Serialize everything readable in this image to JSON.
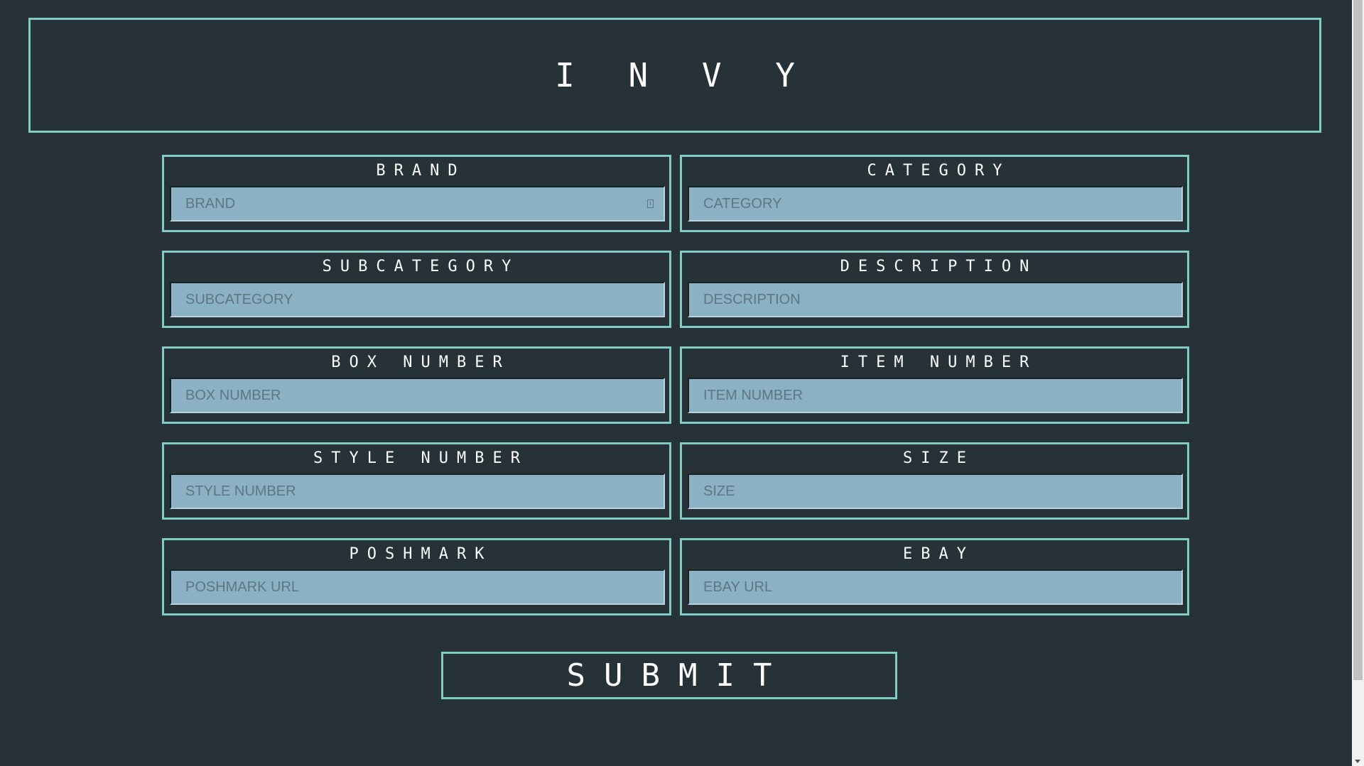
{
  "app": {
    "title": "I N V Y"
  },
  "form": {
    "fields": [
      {
        "label": "BRAND",
        "placeholder": "BRAND"
      },
      {
        "label": "CATEGORY",
        "placeholder": "CATEGORY"
      },
      {
        "label": "SUBCATEGORY",
        "placeholder": "SUBCATEGORY"
      },
      {
        "label": "DESCRIPTION",
        "placeholder": "DESCRIPTION"
      },
      {
        "label": "BOX NUMBER",
        "placeholder": "BOX NUMBER"
      },
      {
        "label": "ITEM NUMBER",
        "placeholder": "ITEM NUMBER"
      },
      {
        "label": "STYLE NUMBER",
        "placeholder": "STYLE NUMBER"
      },
      {
        "label": "SIZE",
        "placeholder": "SIZE"
      },
      {
        "label": "POSHMARK",
        "placeholder": "POSHMARK URL"
      },
      {
        "label": "EBAY",
        "placeholder": "EBAY URL"
      }
    ],
    "submit_label": "SUBMIT"
  },
  "colors": {
    "background": "#263238",
    "accent_border": "#80cbc4",
    "input_fill": "#8ab2c4",
    "text": "#ffffff"
  },
  "icons": {
    "autofill": "contact-card-icon",
    "scroll_down": "chevron-down-icon"
  }
}
